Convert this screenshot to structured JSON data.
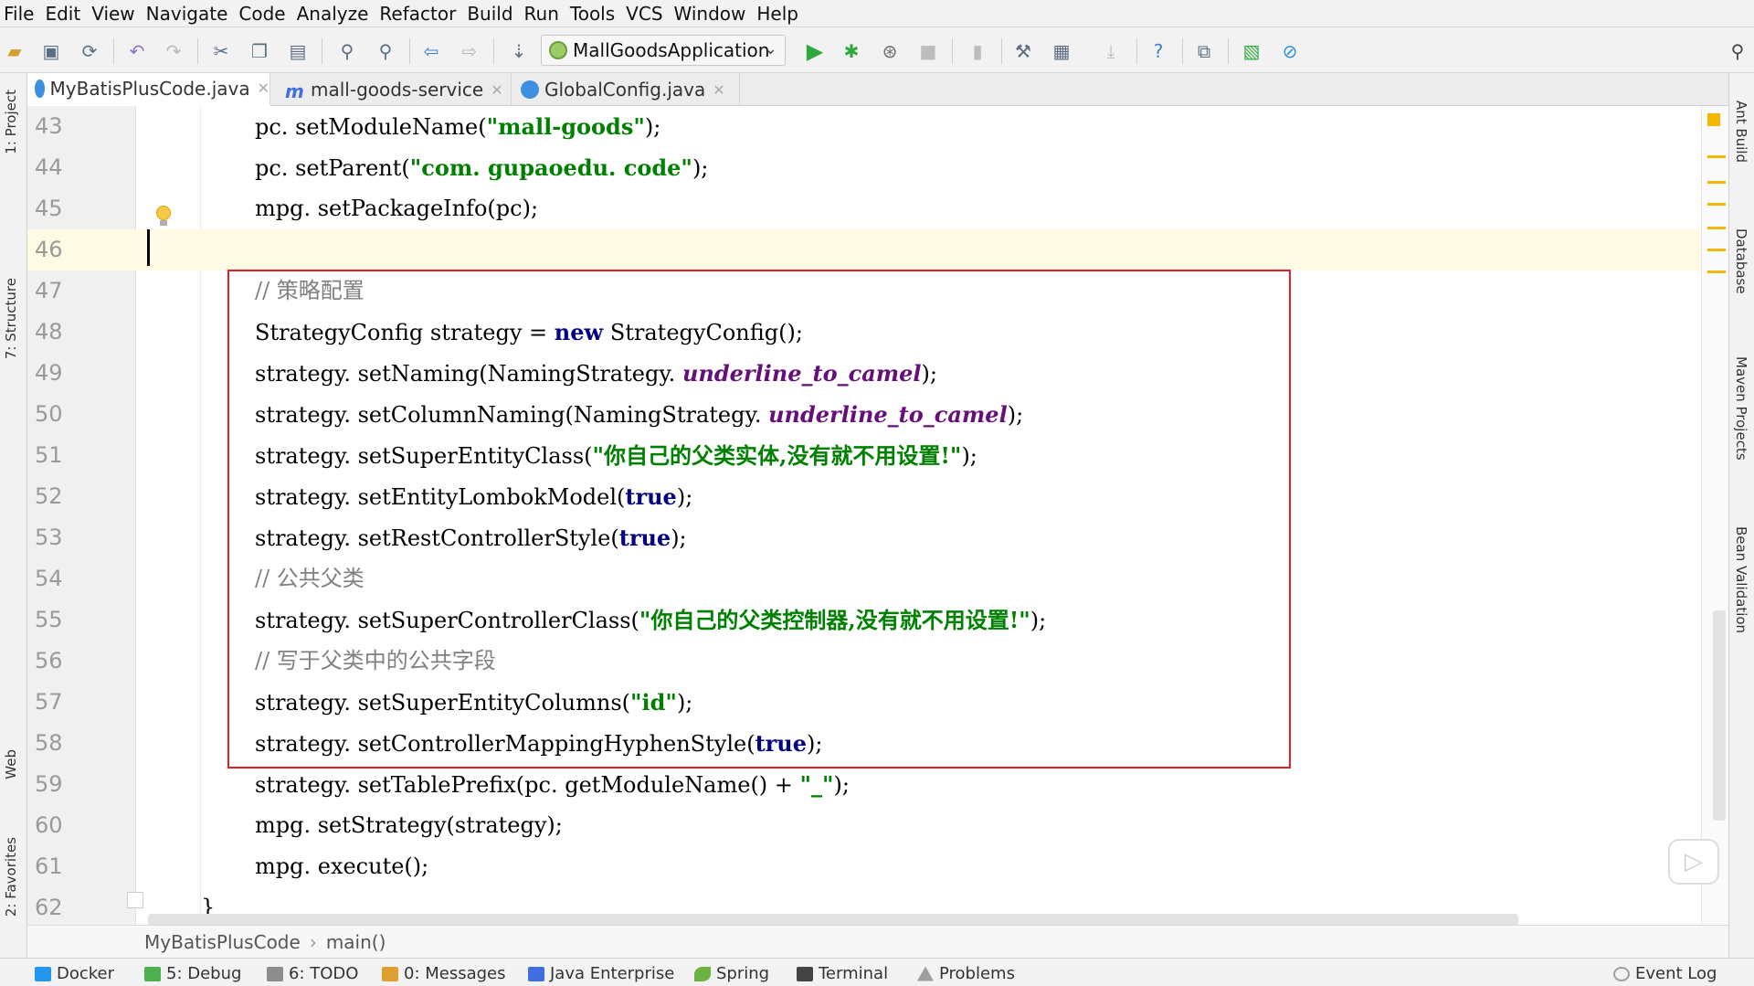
{
  "menu": [
    "File",
    "Edit",
    "View",
    "Navigate",
    "Code",
    "Analyze",
    "Refactor",
    "Build",
    "Run",
    "Tools",
    "VCS",
    "Window",
    "Help"
  ],
  "toolbar": {
    "run_config": "MallGoodsApplication",
    "icons": [
      "open-folder-icon",
      "save-icon",
      "sync-icon",
      "undo-icon",
      "redo-icon",
      "cut-icon",
      "copy-icon",
      "paste-icon",
      "find-icon",
      "replace-icon",
      "back-icon",
      "forward-icon",
      "build-icon",
      "run-icon",
      "debug-icon",
      "coverage-icon",
      "stop-icon",
      "bookmark-icon",
      "settings-icon",
      "structure-icon",
      "update-icon",
      "help-icon",
      "sdk-icon",
      "monitor-icon",
      "disable-icon",
      "search-everywhere-icon"
    ]
  },
  "tabs": [
    {
      "label": "MyBatisPlusCode.java",
      "active": true,
      "color": "#3f8fe0"
    },
    {
      "label": "mall-goods-service",
      "active": false,
      "color": "#3f6ee0"
    },
    {
      "label": "GlobalConfig.java",
      "active": false,
      "color": "#3f8fe0"
    }
  ],
  "left_tools": [
    "1: Project",
    "7: Structure",
    "Web",
    "2: Favorites"
  ],
  "right_tools": [
    "Ant Build",
    "Database",
    "Maven Projects",
    "Bean Validation"
  ],
  "editor": {
    "lines": [
      {
        "n": "43",
        "text": "pc. setModuleName(\"mall-goods\");"
      },
      {
        "n": "44",
        "text": "pc. setParent(\"com. gupaoedu. code\");"
      },
      {
        "n": "45",
        "text": "mpg. setPackageInfo(pc);"
      },
      {
        "n": "46",
        "text": ""
      },
      {
        "n": "47",
        "text": "// 策略配置"
      },
      {
        "n": "48",
        "text": "StrategyConfig strategy = new StrategyConfig();"
      },
      {
        "n": "49",
        "text": "strategy. setNaming(NamingStrategy. underline_to_camel);"
      },
      {
        "n": "50",
        "text": "strategy. setColumnNaming(NamingStrategy. underline_to_camel);"
      },
      {
        "n": "51",
        "text": "strategy. setSuperEntityClass(\"你自己的父类实体,没有就不用设置!\");"
      },
      {
        "n": "52",
        "text": "strategy. setEntityLombokModel(true);"
      },
      {
        "n": "53",
        "text": "strategy. setRestControllerStyle(true);"
      },
      {
        "n": "54",
        "text": "// 公共父类"
      },
      {
        "n": "55",
        "text": "strategy. setSuperControllerClass(\"你自己的父类控制器,没有就不用设置!\");"
      },
      {
        "n": "56",
        "text": "// 写于父类中的公共字段"
      },
      {
        "n": "57",
        "text": "strategy. setSuperEntityColumns(\"id\");"
      },
      {
        "n": "58",
        "text": "strategy. setControllerMappingHyphenStyle(true);"
      },
      {
        "n": "59",
        "text": "strategy. setTablePrefix(pc. getModuleName() + \"_\");"
      },
      {
        "n": "60",
        "text": "mpg. setStrategy(strategy);"
      },
      {
        "n": "61",
        "text": "mpg. execute();"
      },
      {
        "n": "62",
        "text": "}"
      }
    ],
    "current_line": "46"
  },
  "breadcrumb": [
    "MyBatisPlusCode",
    "main()"
  ],
  "statusbar": [
    {
      "label": "Docker",
      "color": "#2496ed"
    },
    {
      "label": "5: Debug",
      "color": "#4caf50"
    },
    {
      "label": "6: TODO",
      "color": "#8d8d8d"
    },
    {
      "label": "0: Messages",
      "color": "#e0a030"
    },
    {
      "label": "Java Enterprise",
      "color": "#3f6ee0"
    },
    {
      "label": "Spring",
      "color": "#6db33f"
    },
    {
      "label": "Terminal",
      "color": "#444444"
    },
    {
      "label": "Problems",
      "color": "#9e9e9e"
    },
    {
      "label": "Event Log",
      "color": "#9e9e9e"
    }
  ],
  "colors": {
    "highlight_box": "#e0202a",
    "current_line_bg": "#fffae3",
    "keyword": "#000080",
    "string": "#008000",
    "comment": "#808080",
    "static_field": "#660e7a"
  }
}
